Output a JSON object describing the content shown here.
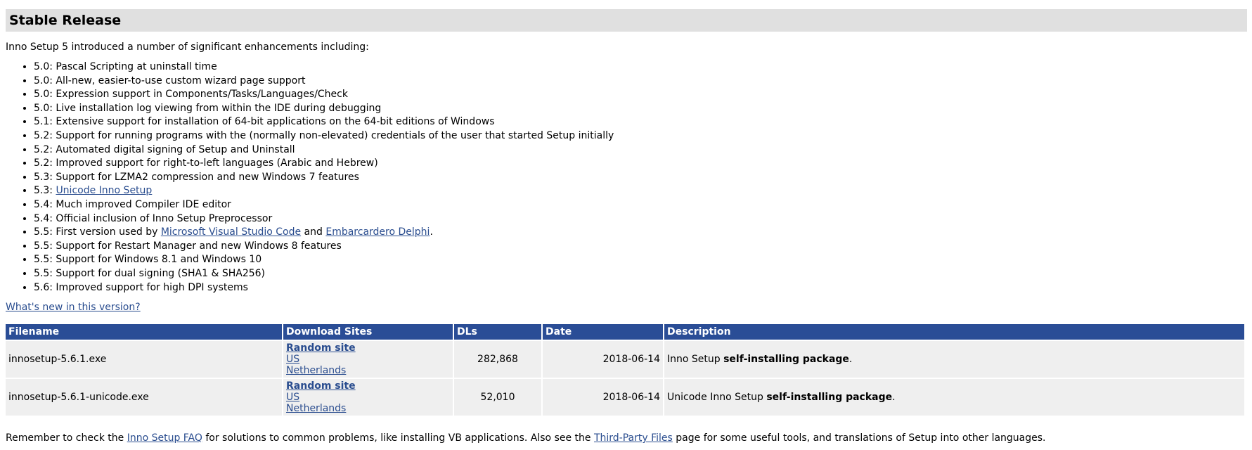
{
  "section": {
    "title": "Stable Release"
  },
  "intro": "Inno Setup 5 introduced a number of significant enhancements including:",
  "features": [
    {
      "text": "5.0: Pascal Scripting at uninstall time"
    },
    {
      "text": "5.0: All-new, easier-to-use custom wizard page support"
    },
    {
      "text": "5.0: Expression support in Components/Tasks/Languages/Check"
    },
    {
      "text": "5.0: Live installation log viewing from within the IDE during debugging"
    },
    {
      "text": "5.1: Extensive support for installation of 64-bit applications on the 64-bit editions of Windows"
    },
    {
      "text": "5.2: Support for running programs with the (normally non-elevated) credentials of the user that started Setup initially"
    },
    {
      "text": "5.2: Automated digital signing of Setup and Uninstall"
    },
    {
      "text": "5.2: Improved support for right-to-left languages (Arabic and Hebrew)"
    },
    {
      "text": "5.3: Support for LZMA2 compression and new Windows 7 features"
    },
    {
      "prefix": "5.3: ",
      "link": "Unicode Inno Setup"
    },
    {
      "text": "5.4: Much improved Compiler IDE editor"
    },
    {
      "text": "5.4: Official inclusion of Inno Setup Preprocessor"
    },
    {
      "prefix": "5.5: First version used by ",
      "link1": "Microsoft Visual Studio Code",
      "middle": " and ",
      "link2": "Embarcardero Delphi",
      "suffix": "."
    },
    {
      "text": "5.5: Support for Restart Manager and new Windows 8 features"
    },
    {
      "text": "5.5: Support for Windows 8.1 and Windows 10"
    },
    {
      "text": "5.5: Support for dual signing (SHA1 & SHA256)"
    },
    {
      "text": "5.6: Improved support for high DPI systems"
    }
  ],
  "whats_new_link": "What's new in this version?",
  "table": {
    "headers": {
      "filename": "Filename",
      "sites": "Download Sites",
      "dls": "DLs",
      "date": "Date",
      "description": "Description"
    },
    "rows": [
      {
        "filename": "innosetup-5.6.1.exe",
        "site_random": "Random site",
        "site_us": "US",
        "site_nl": "Netherlands",
        "dls": "282,868",
        "date": "2018-06-14",
        "desc_prefix": "Inno Setup ",
        "desc_bold": "self-installing package",
        "desc_suffix": "."
      },
      {
        "filename": "innosetup-5.6.1-unicode.exe",
        "site_random": "Random site",
        "site_us": "US",
        "site_nl": "Netherlands",
        "dls": "52,010",
        "date": "2018-06-14",
        "desc_prefix": "Unicode Inno Setup ",
        "desc_bold": "self-installing package",
        "desc_suffix": "."
      }
    ]
  },
  "footer": {
    "part1": "Remember to check the ",
    "link1": "Inno Setup FAQ",
    "part2": " for solutions to common problems, like installing VB applications. Also see the ",
    "link2": "Third-Party Files",
    "part3": " page for some useful tools, and translations of Setup into other languages."
  },
  "colors": {
    "header_bg": "#e0e0e0",
    "table_header_bg": "#2a4d96",
    "table_cell_bg": "#efefef",
    "link": "#2a4d8f"
  }
}
